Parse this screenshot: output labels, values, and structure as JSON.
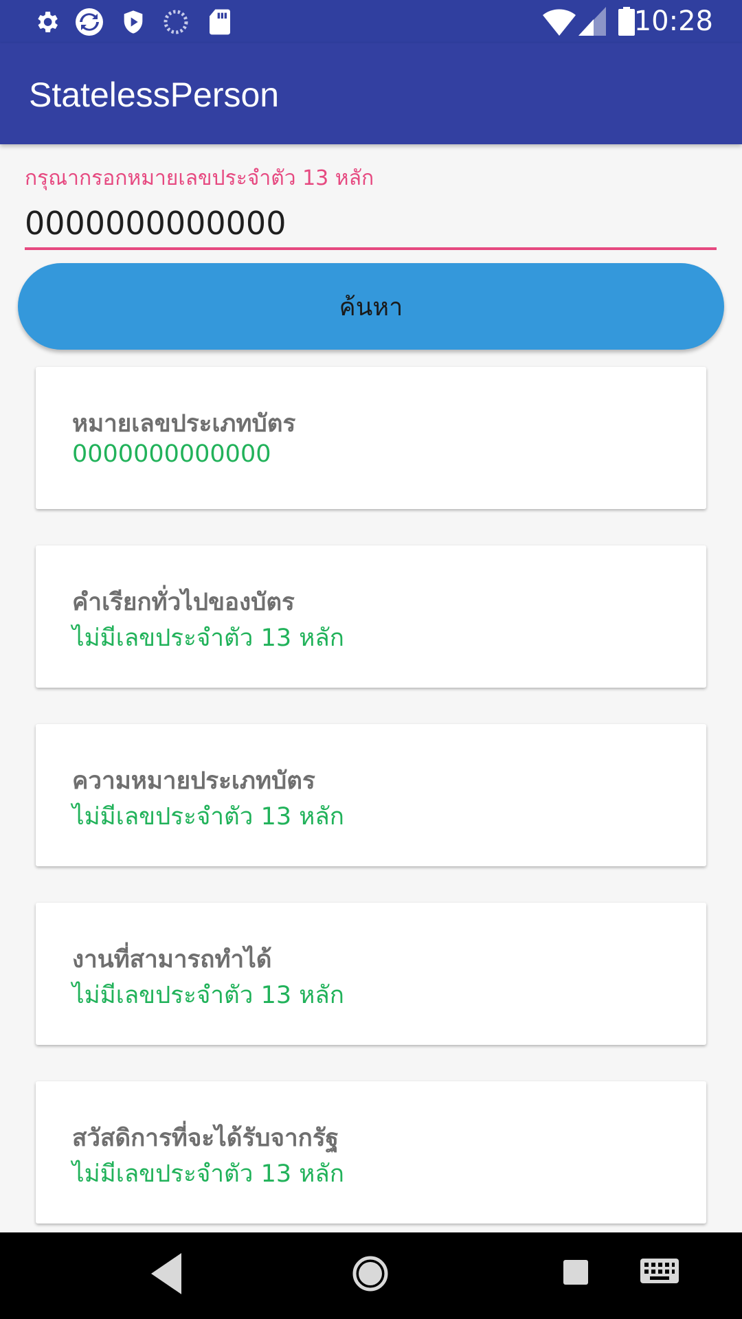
{
  "status_bar": {
    "time": "10:28",
    "left_icons": [
      "settings-icon",
      "sync-app-icon",
      "shield-play-icon",
      "loading-icon",
      "sd-card-icon"
    ],
    "right_icons": [
      "wifi-icon",
      "signal-icon",
      "battery-icon"
    ]
  },
  "app_bar": {
    "title": "StatelessPerson"
  },
  "search": {
    "label": "กรุณากรอกหมายเลขประจำตัว 13 หลัก",
    "value": "0000000000000",
    "button_label": "ค้นหา"
  },
  "cards": [
    {
      "title": "หมายเลขประเภทบัตร",
      "value": "0000000000000"
    },
    {
      "title": "คำเรียกทั่วไปของบัตร",
      "value": "ไม่มีเลขประจำตัว 13 หลัก"
    },
    {
      "title": "ความหมายประเภทบัตร",
      "value": "ไม่มีเลขประจำตัว 13 หลัก"
    },
    {
      "title": "งานที่สามารถทำได้",
      "value": "ไม่มีเลขประจำตัว 13 หลัก"
    },
    {
      "title": "สวัสดิการที่จะได้รับจากรัฐ",
      "value": "ไม่มีเลขประจำตัว 13 หลัก"
    }
  ],
  "nav_bar": {
    "buttons": [
      "back-icon",
      "home-icon",
      "recents-icon",
      "keyboard-icon"
    ]
  },
  "colors": {
    "app_bar": "#3340a1",
    "status_bar": "#303f9f",
    "accent": "#e64980",
    "button": "#3498db",
    "value_text": "#21b25a"
  }
}
